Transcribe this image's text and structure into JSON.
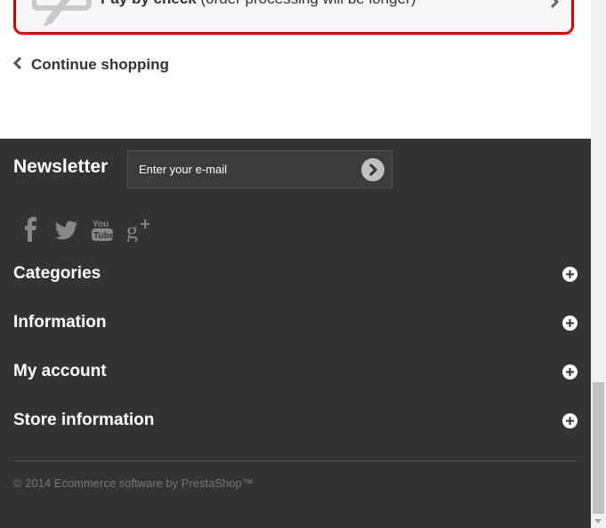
{
  "payment": {
    "title": "Pay by check",
    "subtitle": "(order processing will be longer)"
  },
  "continue": {
    "label": "Continue shopping"
  },
  "newsletter": {
    "title": "Newsletter",
    "placeholder": "Enter your e-mail"
  },
  "social": [
    "facebook-icon",
    "twitter-icon",
    "youtube-icon",
    "google-plus-icon"
  ],
  "sections": [
    {
      "label": "Categories"
    },
    {
      "label": "Information"
    },
    {
      "label": "My account"
    },
    {
      "label": "Store information"
    }
  ],
  "copyright": "© 2014 Ecommerce software by PrestaShop™",
  "colors": {
    "footer_bg": "#333333",
    "accent_border": "#e00000"
  }
}
